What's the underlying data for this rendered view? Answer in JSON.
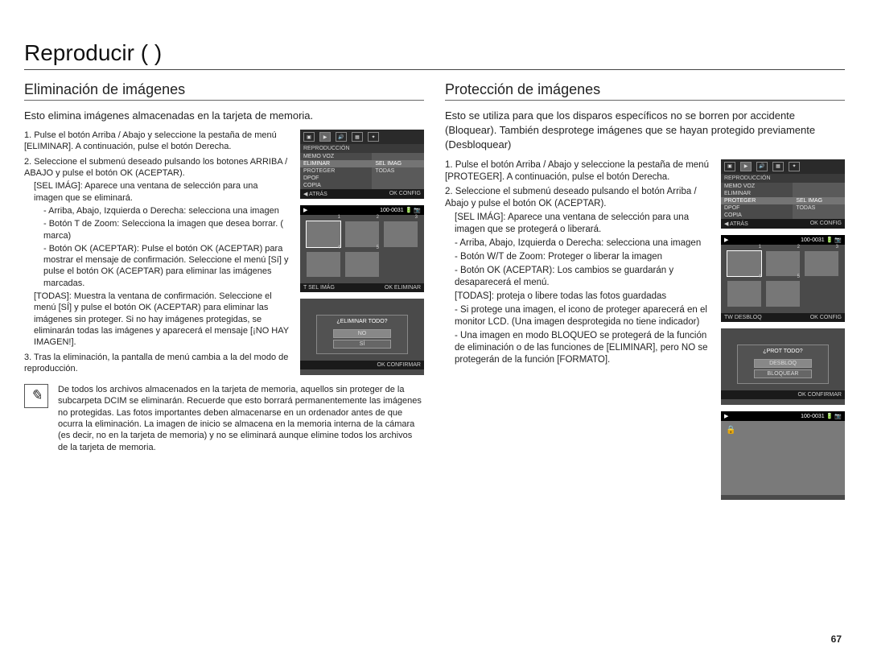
{
  "page_title": "Reproducir (       )",
  "page_number": "67",
  "left": {
    "heading": "Eliminación de imágenes",
    "intro": "Esto elimina imágenes almacenadas en la tarjeta de memoria.",
    "step1": "1. Pulse el botón Arriba / Abajo y seleccione la pestaña de menú [ELIMINAR]. A continuación, pulse el botón Derecha.",
    "step2": "2. Seleccione el submenú deseado pulsando los botones ARRIBA / ABAJO y pulse el botón OK (ACEPTAR).",
    "sel_label": "[SEL IMÁG]: Aparece una ventana de selección para una imagen que se eliminará.",
    "sel_b1": "- Arriba, Abajo, Izquierda o Derecha: selecciona una imagen",
    "sel_b2": "- Botón T de Zoom: Selecciona la imagen que desea borrar. (     marca)",
    "sel_b3": "- Botón OK (ACEPTAR): Pulse el botón OK (ACEPTAR) para mostrar el mensaje de confirmación. Seleccione el menú [Sí] y pulse el botón OK (ACEPTAR) para eliminar las imágenes marcadas.",
    "todas": "[TODAS]: Muestra la ventana de confirmación. Seleccione el menú [SÍ] y pulse el botón OK (ACEPTAR) para eliminar las imágenes sin proteger. Si no hay imágenes protegidas, se eliminarán todas las imágenes y aparecerá el mensaje [¡NO HAY IMAGEN!].",
    "step3": "3. Tras la eliminación, la pantalla de menú cambia a la del modo de reproducción.",
    "note": "De todos los archivos almacenados en la tarjeta de memoria, aquellos sin proteger de la subcarpeta DCIM se eliminarán. Recuerde que esto borrará permanentemente las imágenes no protegidas. Las fotos importantes deben almacenarse en un ordenador antes de que ocurra la eliminación. La imagen de inicio se almacena en la memoria interna de la cámara (es decir, no en la tarjeta de memoria) y no se eliminará aunque elimine todos los archivos de la tarjeta de memoria.",
    "screen_menu": {
      "section": "REPRODUCCIÓN",
      "items_left": [
        "MEMO VOZ",
        "ELIMINAR",
        "PROTEGER",
        "DPOF",
        "COPIA"
      ],
      "items_right": [
        "SEL IMAG",
        "TODAS"
      ],
      "footer_left": "◀ ATRÁS",
      "footer_right": "OK  CONFIG"
    },
    "screen_grid": {
      "topbar_left": "▶",
      "topbar_right": "100-0031  🔋 📷",
      "footer_left": "T  SEL IMÁG",
      "footer_right": "OK  ELIMINAR"
    },
    "screen_dialog": {
      "question": "¿ELIMINAR TODO?",
      "opt_no": "NO",
      "opt_yes": "SÍ",
      "footer_right": "OK  CONFIRMAR"
    }
  },
  "right": {
    "heading": "Protección de imágenes",
    "intro": "Esto se utiliza para que los disparos específicos no se borren por accidente (Bloquear). También desprotege imágenes que se hayan protegido previamente (Desbloquear)",
    "step1": "1. Pulse el botón Arriba / Abajo y seleccione la pestaña de menú [PROTEGER]. A continuación, pulse el botón Derecha.",
    "step2": "2. Seleccione el submenú deseado pulsando el botón Arriba / Abajo y pulse el botón OK (ACEPTAR).",
    "sel_label": "[SEL IMÁG]: Aparece una ventana de selección para una imagen que se protegerá o liberará.",
    "sel_b1": "- Arriba, Abajo, Izquierda o Derecha: selecciona una imagen",
    "sel_b2": "- Botón W/T de Zoom: Proteger o liberar la imagen",
    "sel_b3": "- Botón OK (ACEPTAR): Los cambios se guardarán y desaparecerá el menú.",
    "todas": "[TODAS]: proteja o libere todas las fotos guardadas",
    "todas_b1": "- Si protege una imagen, el icono de proteger aparecerá en el monitor LCD. (Una imagen desprotegida no tiene indicador)",
    "todas_b2": "- Una imagen en modo BLOQUEO se protegerá de la función de eliminación o de las funciones de [ELIMINAR], pero NO se protegerán de la función [FORMATO].",
    "screen_menu": {
      "section": "REPRODUCCIÓN",
      "items_left": [
        "MEMO VOZ",
        "ELIMINAR",
        "PROTEGER",
        "DPOF",
        "COPIA"
      ],
      "items_right": [
        "SEL IMAG",
        "TODAS"
      ],
      "footer_left": "◀ ATRÁS",
      "footer_right": "OK  CONFIG"
    },
    "screen_grid": {
      "topbar_left": "▶",
      "topbar_right": "100-0031  🔋 📷",
      "footer_left": "TW  DESBLOQ",
      "footer_right": "OK  CONFIG"
    },
    "screen_dialog": {
      "question": "¿PROT TODO?",
      "opt1": "DESBLOQ",
      "opt2": "BLOQUEAR",
      "footer_right": "OK  CONFIRMAR"
    },
    "screen_preview": {
      "topbar_left": "▶",
      "topbar_right": "100-0031  🔋 📷"
    }
  }
}
